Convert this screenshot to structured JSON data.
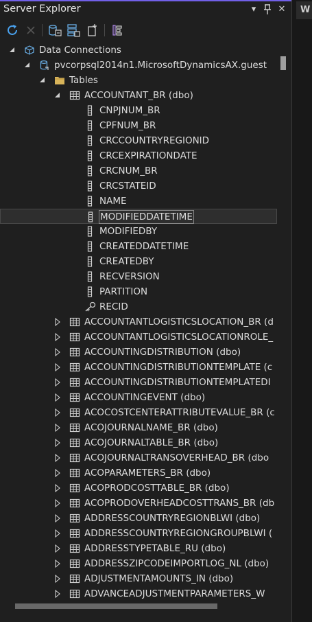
{
  "panel": {
    "title": "Server Explorer",
    "controls": {
      "dropdown": "▾",
      "pin": "⊓",
      "close": "✕"
    }
  },
  "right_panel": {
    "tab_letter": "W"
  },
  "toolbar": {
    "buttons": [
      {
        "name": "refresh-button",
        "icon": "refresh-icon"
      },
      {
        "name": "stop-button",
        "icon": "close-icon",
        "disabled": true
      },
      {
        "name": "connect-database-button",
        "icon": "connect-database-icon"
      },
      {
        "name": "connect-server-button",
        "icon": "connect-server-icon"
      },
      {
        "name": "connect-azure-button",
        "icon": "add-connection-icon"
      },
      {
        "name": "filter-button",
        "icon": "filter-icon"
      }
    ]
  },
  "tree": {
    "rows": [
      {
        "level": 0,
        "state": "expanded",
        "icon": "data-connections-icon",
        "label": "Data Connections"
      },
      {
        "level": 1,
        "state": "expanded",
        "icon": "database-connection-icon",
        "label": "pvcorpsql2014n1.MicrosoftDynamicsAX.guest"
      },
      {
        "level": 2,
        "state": "expanded",
        "icon": "folder-icon",
        "label": "Tables"
      },
      {
        "level": 3,
        "state": "expanded",
        "icon": "table-icon",
        "label": "ACCOUNTANT_BR (dbo)"
      },
      {
        "level": 4,
        "state": "leaf",
        "icon": "column-icon",
        "label": "CNPJNUM_BR"
      },
      {
        "level": 4,
        "state": "leaf",
        "icon": "column-icon",
        "label": "CPFNUM_BR"
      },
      {
        "level": 4,
        "state": "leaf",
        "icon": "column-icon",
        "label": "CRCCOUNTRYREGIONID"
      },
      {
        "level": 4,
        "state": "leaf",
        "icon": "column-icon",
        "label": "CRCEXPIRATIONDATE"
      },
      {
        "level": 4,
        "state": "leaf",
        "icon": "column-icon",
        "label": "CRCNUM_BR"
      },
      {
        "level": 4,
        "state": "leaf",
        "icon": "column-icon",
        "label": "CRCSTATEID"
      },
      {
        "level": 4,
        "state": "leaf",
        "icon": "column-icon",
        "label": "NAME"
      },
      {
        "level": 4,
        "state": "leaf",
        "icon": "column-icon",
        "label": "MODIFIEDDATETIME",
        "selected": true
      },
      {
        "level": 4,
        "state": "leaf",
        "icon": "column-icon",
        "label": "MODIFIEDBY"
      },
      {
        "level": 4,
        "state": "leaf",
        "icon": "column-icon",
        "label": "CREATEDDATETIME"
      },
      {
        "level": 4,
        "state": "leaf",
        "icon": "column-icon",
        "label": "CREATEDBY"
      },
      {
        "level": 4,
        "state": "leaf",
        "icon": "column-icon",
        "label": "RECVERSION"
      },
      {
        "level": 4,
        "state": "leaf",
        "icon": "column-icon",
        "label": "PARTITION"
      },
      {
        "level": 4,
        "state": "leaf",
        "icon": "key-icon",
        "label": "RECID"
      },
      {
        "level": 3,
        "state": "collapsed",
        "icon": "table-icon",
        "label": "ACCOUNTANTLOGISTICSLOCATION_BR (d"
      },
      {
        "level": 3,
        "state": "collapsed",
        "icon": "table-icon",
        "label": "ACCOUNTANTLOGISTICSLOCATIONROLE_"
      },
      {
        "level": 3,
        "state": "collapsed",
        "icon": "table-icon",
        "label": "ACCOUNTINGDISTRIBUTION (dbo)"
      },
      {
        "level": 3,
        "state": "collapsed",
        "icon": "table-icon",
        "label": "ACCOUNTINGDISTRIBUTIONTEMPLATE (c"
      },
      {
        "level": 3,
        "state": "collapsed",
        "icon": "table-icon",
        "label": "ACCOUNTINGDISTRIBUTIONTEMPLATEDI"
      },
      {
        "level": 3,
        "state": "collapsed",
        "icon": "table-icon",
        "label": "ACCOUNTINGEVENT (dbo)"
      },
      {
        "level": 3,
        "state": "collapsed",
        "icon": "table-icon",
        "label": "ACOCOSTCENTERATTRIBUTEVALUE_BR (c"
      },
      {
        "level": 3,
        "state": "collapsed",
        "icon": "table-icon",
        "label": "ACOJOURNALNAME_BR (dbo)"
      },
      {
        "level": 3,
        "state": "collapsed",
        "icon": "table-icon",
        "label": "ACOJOURNALTABLE_BR (dbo)"
      },
      {
        "level": 3,
        "state": "collapsed",
        "icon": "table-icon",
        "label": "ACOJOURNALTRANSOVERHEAD_BR (dbo"
      },
      {
        "level": 3,
        "state": "collapsed",
        "icon": "table-icon",
        "label": "ACOPARAMETERS_BR (dbo)"
      },
      {
        "level": 3,
        "state": "collapsed",
        "icon": "table-icon",
        "label": "ACOPRODCOSTTABLE_BR (dbo)"
      },
      {
        "level": 3,
        "state": "collapsed",
        "icon": "table-icon",
        "label": "ACOPRODOVERHEADCOSTTRANS_BR (db"
      },
      {
        "level": 3,
        "state": "collapsed",
        "icon": "table-icon",
        "label": "ADDRESSCOUNTRYREGIONBLWI (dbo)"
      },
      {
        "level": 3,
        "state": "collapsed",
        "icon": "table-icon",
        "label": "ADDRESSCOUNTRYREGIONGROUPBLWI ("
      },
      {
        "level": 3,
        "state": "collapsed",
        "icon": "table-icon",
        "label": "ADDRESSTYPETABLE_RU (dbo)"
      },
      {
        "level": 3,
        "state": "collapsed",
        "icon": "table-icon",
        "label": "ADDRESSZIPCODEIMPORTLOG_NL (dbo)"
      },
      {
        "level": 3,
        "state": "collapsed",
        "icon": "table-icon",
        "label": "ADJUSTMENTAMOUNTS_IN (dbo)"
      },
      {
        "level": 3,
        "state": "collapsed",
        "icon": "table-icon",
        "label": "ADVANCEADJUSTMENTPARAMETERS_W"
      }
    ]
  },
  "colors": {
    "accent": "#7160e8",
    "refresh": "#4aa3f0",
    "folder": "#d8b45a",
    "db_icon": "#6ab0e8"
  },
  "scroll": {
    "vertical_position": 0.0,
    "horizontal_fraction_visible": 0.75
  }
}
